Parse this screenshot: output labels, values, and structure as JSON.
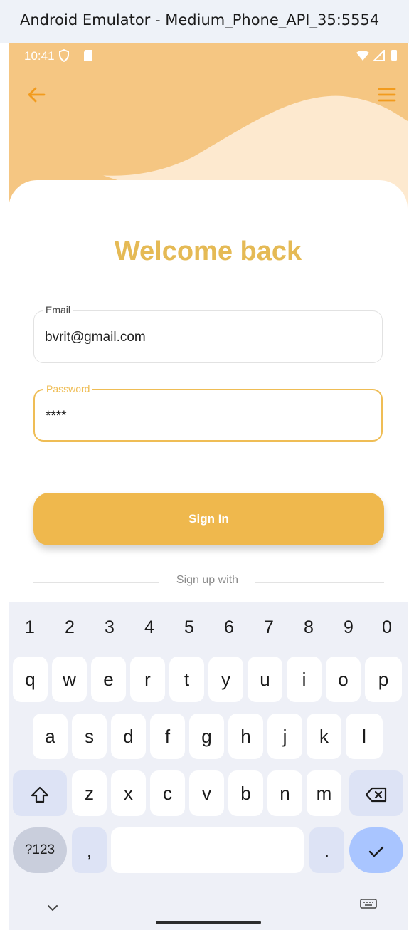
{
  "window": {
    "title": "Android Emulator - Medium_Phone_API_35:5554"
  },
  "status_bar": {
    "time": "10:41"
  },
  "form": {
    "title": "Welcome back",
    "email": {
      "label": "Email",
      "value": "bvrit@gmail.com"
    },
    "password": {
      "label": "Password",
      "value": "****"
    },
    "signin_label": "Sign In",
    "signup_with": "Sign up with"
  },
  "keyboard": {
    "numbers": [
      "1",
      "2",
      "3",
      "4",
      "5",
      "6",
      "7",
      "8",
      "9",
      "0"
    ],
    "row1": [
      "q",
      "w",
      "e",
      "r",
      "t",
      "y",
      "u",
      "i",
      "o",
      "p"
    ],
    "row2": [
      "a",
      "s",
      "d",
      "f",
      "g",
      "h",
      "j",
      "k",
      "l"
    ],
    "row3": [
      "z",
      "x",
      "c",
      "v",
      "b",
      "n",
      "m"
    ],
    "symbols_label": "?123",
    "comma": ",",
    "period": "."
  },
  "colors": {
    "header": "#f5c682",
    "accent": "#efb84d",
    "title": "#e5ba55",
    "wave_light": "#fde9cf"
  }
}
